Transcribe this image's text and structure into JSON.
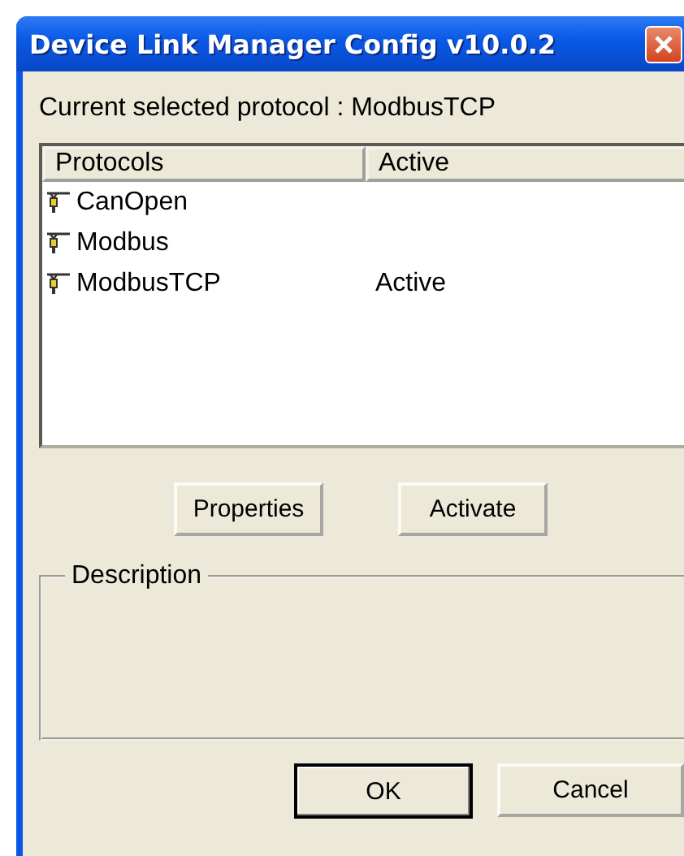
{
  "window": {
    "title": "Device Link Manager Config v10.0.2"
  },
  "current_protocol_label": "Current selected protocol : ModbusTCP",
  "table": {
    "columns": [
      "Protocols",
      "Active"
    ],
    "rows": [
      {
        "protocol": "CanOpen",
        "active": ""
      },
      {
        "protocol": "Modbus",
        "active": ""
      },
      {
        "protocol": "ModbusTCP",
        "active": "Active"
      }
    ]
  },
  "actions": [
    "Properties",
    "Activate"
  ],
  "description": {
    "title": "Description"
  },
  "buttons": [
    {
      "label": "OK",
      "default": true
    },
    {
      "label": "Cancel",
      "default": false
    }
  ]
}
